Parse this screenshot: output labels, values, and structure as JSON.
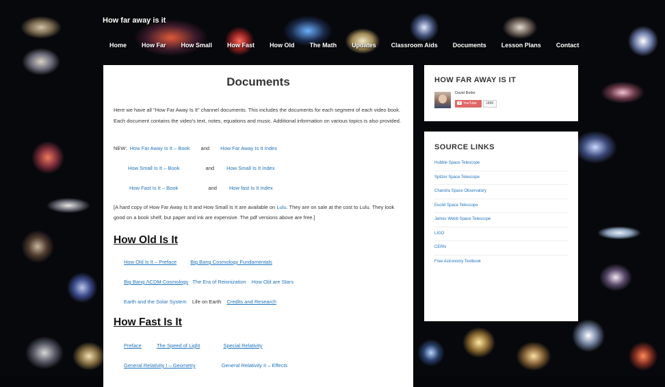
{
  "site": {
    "title": "How far away is it"
  },
  "nav": [
    "Home",
    "How Far",
    "How Small",
    "How Fast",
    "How Old",
    "The Math",
    "Updates",
    "Classroom Aids",
    "Documents",
    "Lesson Plans",
    "Contact"
  ],
  "main": {
    "title": "Documents",
    "intro": "Here we have all \"How Far Away Is It\" channel documents. This includes the documents for each segment of each video book. Each document contains the video's text, notes, equations and music. Additional information on various topics is also provided.",
    "new_prefix": "NEW:",
    "and": "and",
    "books": [
      {
        "book": "How Far Away Is It – Book",
        "index": "How Far Away Is It Index"
      },
      {
        "book": "How Small Is It – Book",
        "index": "How Small Is It Index"
      },
      {
        "book": "How Fast Is It – Book",
        "index": "How fast Is It Index"
      }
    ],
    "note_1": "[A hard copy of How Far Away Is It and How Small Is It are available on ",
    "note_link": "Lulu",
    "note_2": ". They are on sale at the cost to Lulu. They look good on a book shelf, but paper and ink are expensive. The pdf versions above are free.]",
    "how_old": {
      "heading": "How Old Is It",
      "row1": [
        "How Old Is It – Preface",
        "Big Bang Cosmology Fundamentals"
      ],
      "row2": [
        "Big Bang ΛCDM Cosmology",
        "The Era of Reionization",
        "How Old are Stars"
      ],
      "row3": [
        "Earth and the Solar System",
        "Life on Earth",
        "Credits and Research"
      ]
    },
    "how_fast": {
      "heading": "How Fast Is It",
      "row1": [
        "Preface",
        "The Speed of Light",
        "Special Relativity"
      ],
      "row2": [
        "General Relativity I – Geometry",
        "General Relativity II – Effects"
      ]
    }
  },
  "sidebar": {
    "channel": {
      "heading": "HOW FAR AWAY IS IT",
      "author": "David Butler",
      "youtube_label": "YouTube",
      "subscribers": "188K"
    },
    "sources": {
      "heading": "SOURCE LINKS",
      "links": [
        "Hubble Space Telescope",
        "Spitzer Space Telescope",
        "Chandra Space Observatory",
        "Euclid Space Telescope",
        "James Webb Space Telescope",
        "LIGO",
        "CERN",
        "Free Astronomy Textbook"
      ]
    }
  }
}
